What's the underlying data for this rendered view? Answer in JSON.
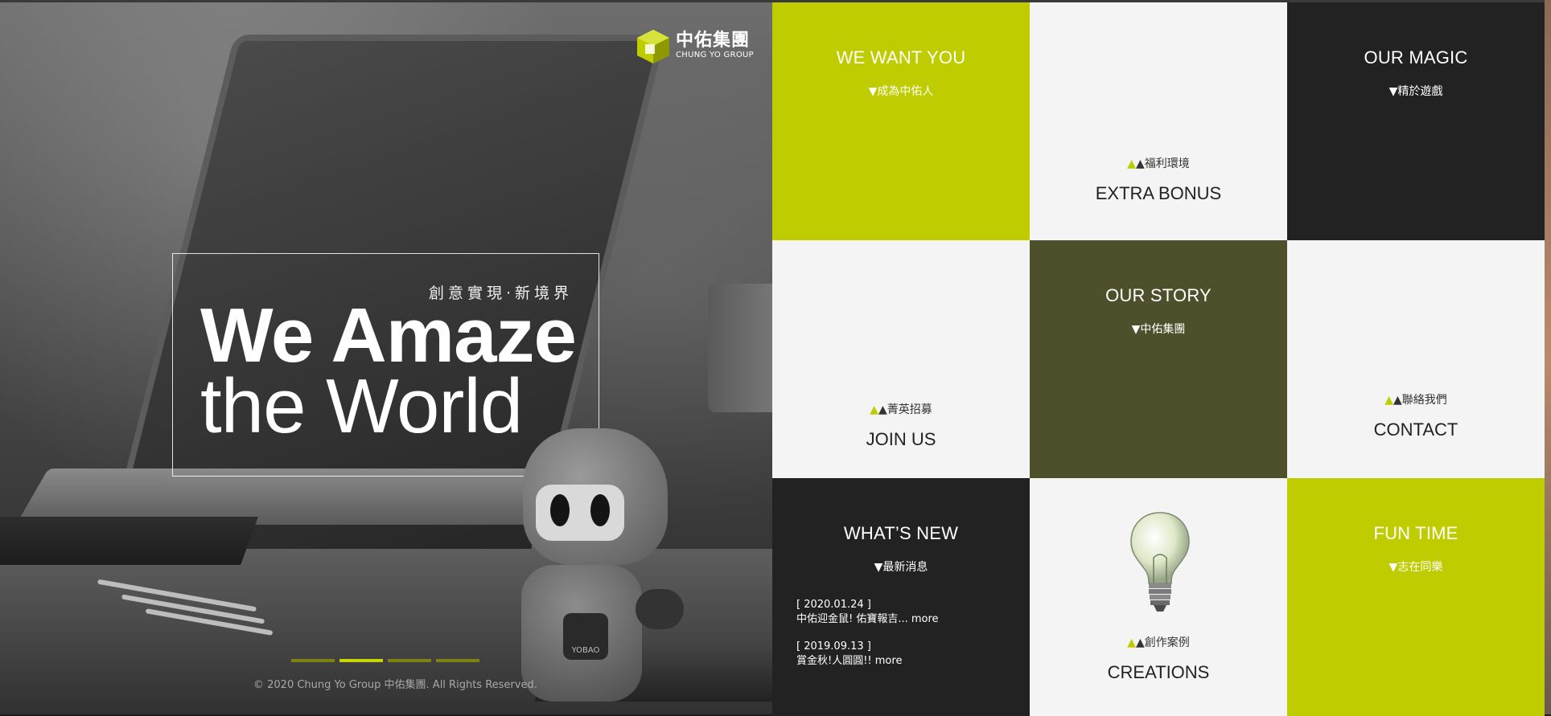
{
  "logo": {
    "cn": "中佑集團",
    "en": "CHUNG YO GROUP"
  },
  "hero": {
    "tagline_sub": "創意實現·新境界",
    "tagline_line1": "We Amaze",
    "tagline_line2": "the World",
    "mascot_badge": "YOBAO",
    "slider": {
      "count": 4,
      "active_index": 1
    },
    "copyright": "© 2020 Chung Yo Group 中佑集團. All Rights Reserved."
  },
  "tiles": {
    "we_want_you": {
      "title": "WE WANT YOU",
      "sub": "▼成為中佑人"
    },
    "extra_bonus": {
      "sub": "▲福利環境",
      "title": "EXTRA BONUS"
    },
    "our_magic": {
      "title": "OUR MAGIC",
      "sub": "▼精於遊戲"
    },
    "join_us": {
      "sub": "▲菁英招募",
      "title": "JOIN US"
    },
    "our_story": {
      "title": "OUR STORY",
      "sub": "▼中佑集團"
    },
    "contact": {
      "sub": "▲聯絡我們",
      "title": "CONTACT"
    },
    "whats_new": {
      "title": "WHAT’S NEW",
      "sub": "▼最新消息",
      "news": [
        {
          "date": "[ 2020.01.24 ]",
          "text": "中佑迎金鼠! 佑寶報吉... more"
        },
        {
          "date": "[ 2019.09.13 ]",
          "text": "賞金秋!人圓圓!! more"
        }
      ]
    },
    "creations": {
      "sub": "▲創作案例",
      "title": "CREATIONS"
    },
    "fun_time": {
      "title": "FUN TIME",
      "sub": "▼志在同樂"
    }
  },
  "colors": {
    "lime": "#bfcd00",
    "light": "#f4f4f4",
    "dark": "#222222",
    "olive": "#4d502a"
  }
}
